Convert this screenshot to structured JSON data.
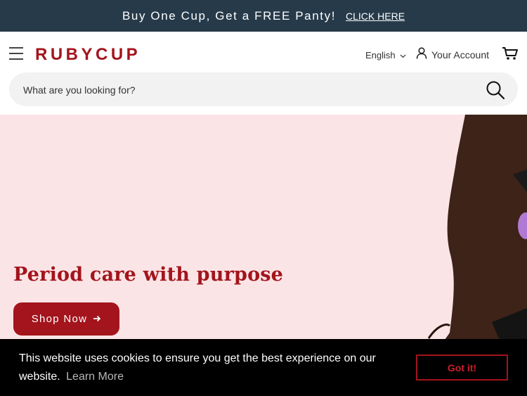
{
  "announcement": {
    "text": "Buy One Cup, Get a FREE Panty!",
    "link_label": "CLICK HERE"
  },
  "header": {
    "logo_text": "RUBYCUP",
    "language": "English",
    "account_label": "Your Account",
    "icons": {
      "menu": "hamburger-menu-icon",
      "language_dropdown": "chevron-down-icon",
      "account": "user-icon",
      "cart": "cart-icon",
      "search": "search-icon"
    }
  },
  "search": {
    "placeholder": "What are you looking for?",
    "value": ""
  },
  "hero": {
    "headline": "Period care with purpose",
    "cta_label": "Shop Now",
    "cta_icon": "arrow-right-icon"
  },
  "cookie_banner": {
    "message": "This website uses cookies to ensure you get the best experience on our website.",
    "learn_more_label": "Learn More",
    "accept_label": "Got it!"
  },
  "colors": {
    "brand_red": "#a3141c",
    "announcement_bg": "#263a4a",
    "hero_bg": "#fbe4e6",
    "cookie_bg": "#000000"
  }
}
